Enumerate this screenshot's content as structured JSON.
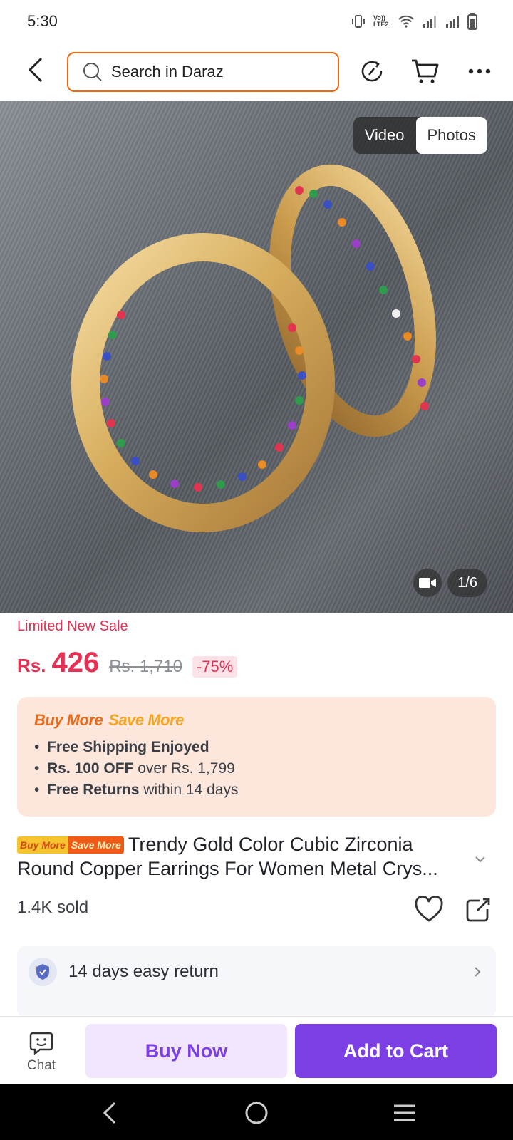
{
  "status_bar": {
    "time": "5:30",
    "network_label": "Vo)) LTE2"
  },
  "header": {
    "search_placeholder": "Search in Daraz"
  },
  "gallery": {
    "tabs": [
      {
        "label": "Video"
      },
      {
        "label": "Photos"
      }
    ],
    "active_tab": "Photos",
    "counter": "1/6"
  },
  "price": {
    "sale_label": "Limited New Sale",
    "currency": "Rs.",
    "current": "426",
    "original": "Rs. 1,710",
    "discount": "-75%"
  },
  "promo": {
    "title_part1": "Buy More",
    "title_part2": "Save More",
    "items": [
      {
        "bold": "Free Shipping Enjoyed",
        "rest": ""
      },
      {
        "bold": "Rs. 100 OFF",
        "rest": " over Rs. 1,799"
      },
      {
        "bold": "Free Returns",
        "rest": " within 14 days"
      }
    ]
  },
  "product": {
    "tag_part1": "Buy More",
    "tag_part2": "Save More",
    "title": "Trendy Gold Color Cubic Zirconia Round Copper Earrings For Women Metal Crys...",
    "sold": "1.4K sold"
  },
  "services": {
    "return_label": "14 days easy return"
  },
  "bottom_bar": {
    "chat_label": "Chat",
    "buy_now": "Buy Now",
    "add_to_cart": "Add to Cart"
  },
  "colors": {
    "accent_purple": "#7b3fe4",
    "price_red": "#e53054",
    "search_border": "#f26a10"
  }
}
